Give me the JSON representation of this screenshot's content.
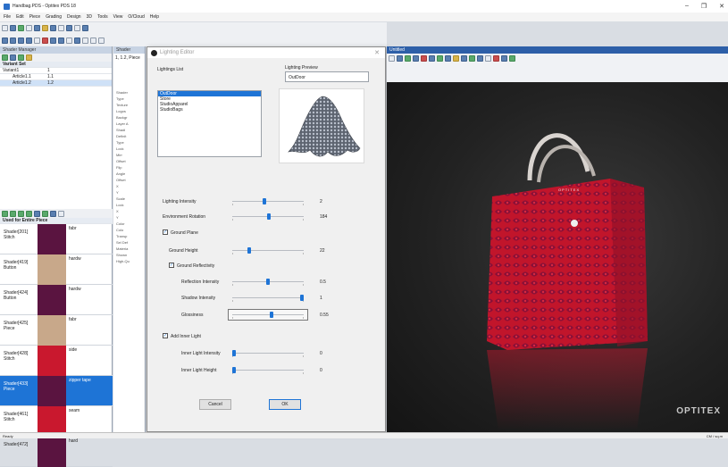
{
  "app": {
    "title": "Handbag.PDS - Optitex PDS 18"
  },
  "menu": [
    "File",
    "Edit",
    "Piece",
    "Grading",
    "Design",
    "3D",
    "Tools",
    "View",
    "O/Cloud",
    "Help"
  ],
  "window_controls": {
    "minimize": "–",
    "maximize": "❐",
    "close": "✕"
  },
  "shader_manager": {
    "title": "Shader Manager",
    "variant_header": "Variant Set",
    "variants": [
      {
        "name": "Variant1",
        "value": "1"
      },
      {
        "name": "Article1.1",
        "value": "1.1"
      },
      {
        "name": "Article1.2",
        "value": "1.2"
      }
    ],
    "used_header": "Used for Entire Piece",
    "shaders": [
      {
        "name": "Shader[201]",
        "type": "Stitch",
        "tag": "fabr",
        "color": "#5a1440"
      },
      {
        "name": "Shader[419]",
        "type": "Button",
        "tag": "hardw",
        "color": "#c8a88a"
      },
      {
        "name": "Shader[424]",
        "type": "Button",
        "tag": "hardw",
        "color": "#5a1440"
      },
      {
        "name": "Shader[425]",
        "type": "Piece",
        "tag": "fabr",
        "color": "#c8a88a"
      },
      {
        "name": "Shader[428]",
        "type": "Stitch",
        "tag": "side",
        "color": "#c9182e"
      },
      {
        "name": "Shader[433]",
        "type": "Piece",
        "tag": "zipper tape",
        "color": "#5a1440"
      },
      {
        "name": "Shader[461]",
        "type": "Stitch",
        "tag": "seam",
        "color": "#c9182e"
      },
      {
        "name": "Shader[472]",
        "type": "",
        "tag": "hard",
        "color": "#5a1440"
      }
    ]
  },
  "middle_panel": {
    "title": "Shader",
    "subtitle": "1, 1.2, Piece",
    "props": [
      "Shader",
      "Type",
      "Texture",
      "Logos",
      "Backgr",
      "Layer A",
      "Shadi",
      "Definit",
      "Type",
      "Lock",
      "Mirr",
      "Offset",
      "Flip",
      "Angle",
      "Offset",
      "X",
      "Y",
      "Scale",
      "Lock",
      "X",
      "Y",
      "Color",
      "Colo",
      "Transp",
      "Sel Def",
      "Materia",
      "Shown",
      "High-Qu"
    ]
  },
  "lighting_editor": {
    "title": "Lighting Editor",
    "lightings_list_label": "Lightings List",
    "lightings": [
      "OutDoor",
      "Store",
      "StudioApparel",
      "StudioBags"
    ],
    "selected_lighting": "OutDoor",
    "preview_label": "Lighting Preview",
    "preview_name": "OutDoor",
    "close": "✕",
    "lighting_intensity": {
      "label": "Lighting Intensity",
      "value": "2",
      "fraction": 0.45
    },
    "environment_rotation": {
      "label": "Environment Rotation",
      "value": "184",
      "fraction": 0.51
    },
    "ground_plane": {
      "label": "Ground Plane",
      "checked": true
    },
    "ground_height": {
      "label": "Ground Height",
      "value": "22",
      "fraction": 0.22
    },
    "ground_reflectivity": {
      "label": "Ground Reflectivity",
      "checked": true
    },
    "reflection_intensity": {
      "label": "Reflection Intensity",
      "value": "0.5",
      "fraction": 0.5
    },
    "shadow_intensity": {
      "label": "Shadow Intensity",
      "value": "1",
      "fraction": 1.0
    },
    "glossiness": {
      "label": "Glossiness",
      "value": "0.55",
      "fraction": 0.55
    },
    "add_inner_light": {
      "label": "Add Inner Light",
      "checked": true
    },
    "inner_light_intensity": {
      "label": "Inner Light Intensity",
      "value": "0",
      "fraction": 0.0
    },
    "inner_light_height": {
      "label": "Inner Light Height",
      "value": "0",
      "fraction": 0.0
    },
    "cancel": "Cancel",
    "ok": "OK"
  },
  "view3d": {
    "title": "Untitled",
    "watermark": "OPTITEX",
    "bag_brand": "OPTITEX"
  },
  "status": {
    "left": "Ready",
    "right": "CM / sq.m"
  },
  "colors": {
    "accent": "#1e74d6",
    "bag_red": "#c1152b",
    "bag_pattern": "#7a0f3a"
  }
}
